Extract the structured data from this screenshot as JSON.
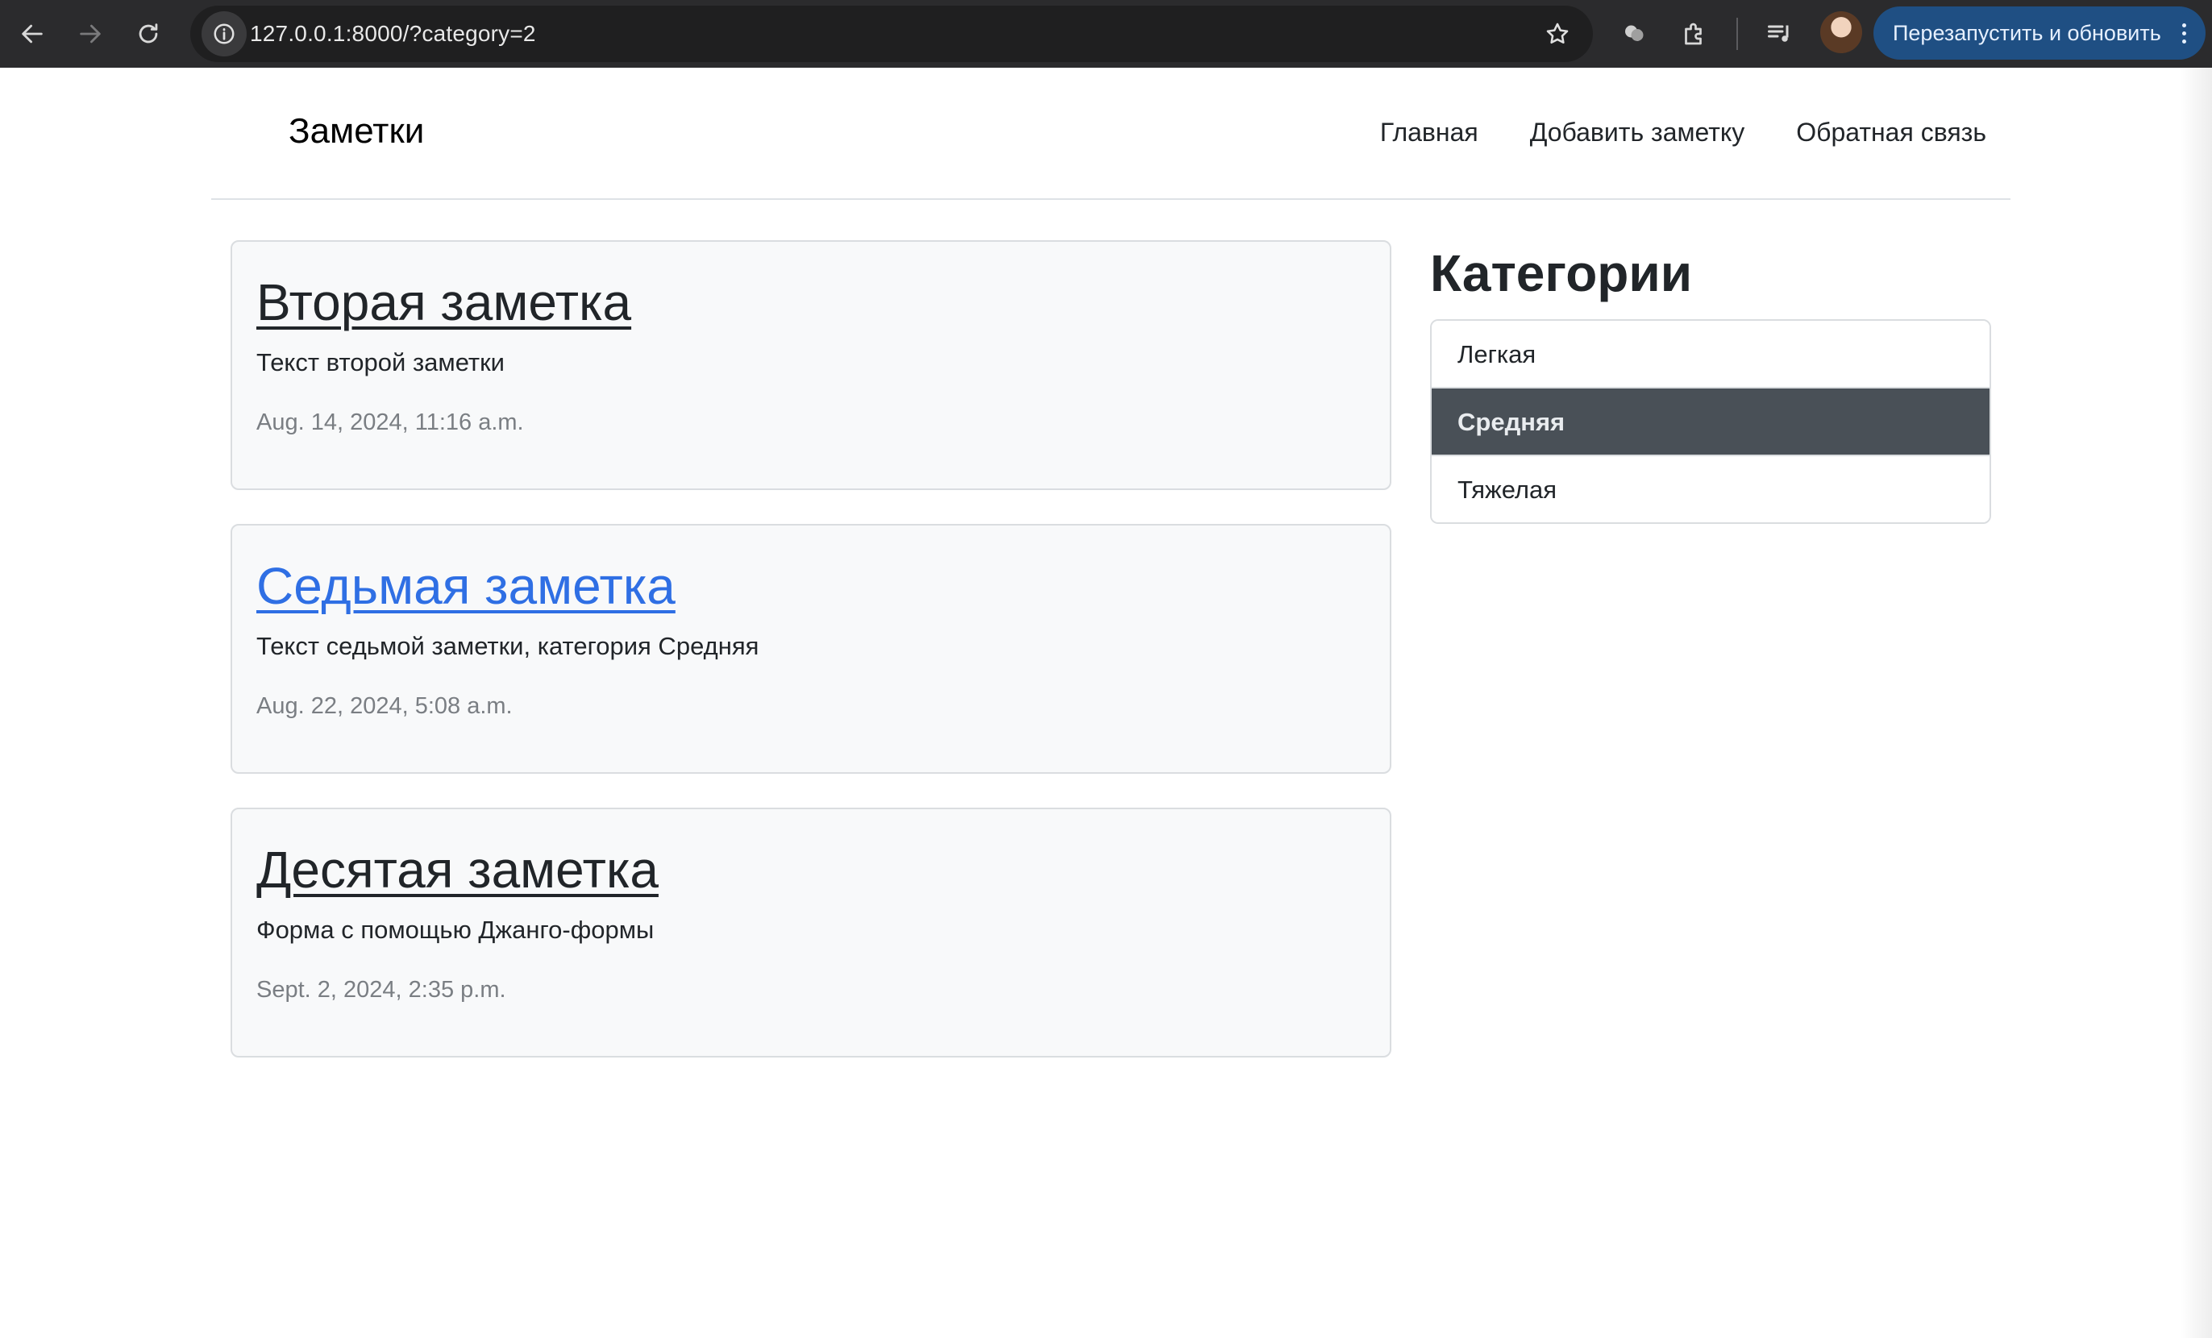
{
  "browser": {
    "url": "127.0.0.1:8000/?category=2",
    "relaunch_label": "Перезапустить и обновить"
  },
  "header": {
    "brand": "Заметки",
    "nav": [
      "Главная",
      "Добавить заметку",
      "Обратная связь"
    ]
  },
  "notes": [
    {
      "title": "Вторая заметка",
      "text": "Текст второй заметки",
      "date": "Aug. 14, 2024, 11:16 a.m."
    },
    {
      "title": "Седьмая заметка",
      "text": "Текст седьмой заметки, категория Средняя",
      "date": "Aug. 22, 2024, 5:08 a.m."
    },
    {
      "title": "Десятая заметка",
      "text": "Форма с помощью Джанго-формы",
      "date": "Sept. 2, 2024, 2:35 p.m."
    }
  ],
  "sidebar": {
    "heading": "Категории",
    "categories": [
      "Легкая",
      "Средняя",
      "Тяжелая"
    ],
    "active_category": "Средняя"
  },
  "colors": {
    "active_category_bg": "#495057",
    "link_hover": "#2f6fe4",
    "relaunch_bg": "#1f4f83"
  }
}
